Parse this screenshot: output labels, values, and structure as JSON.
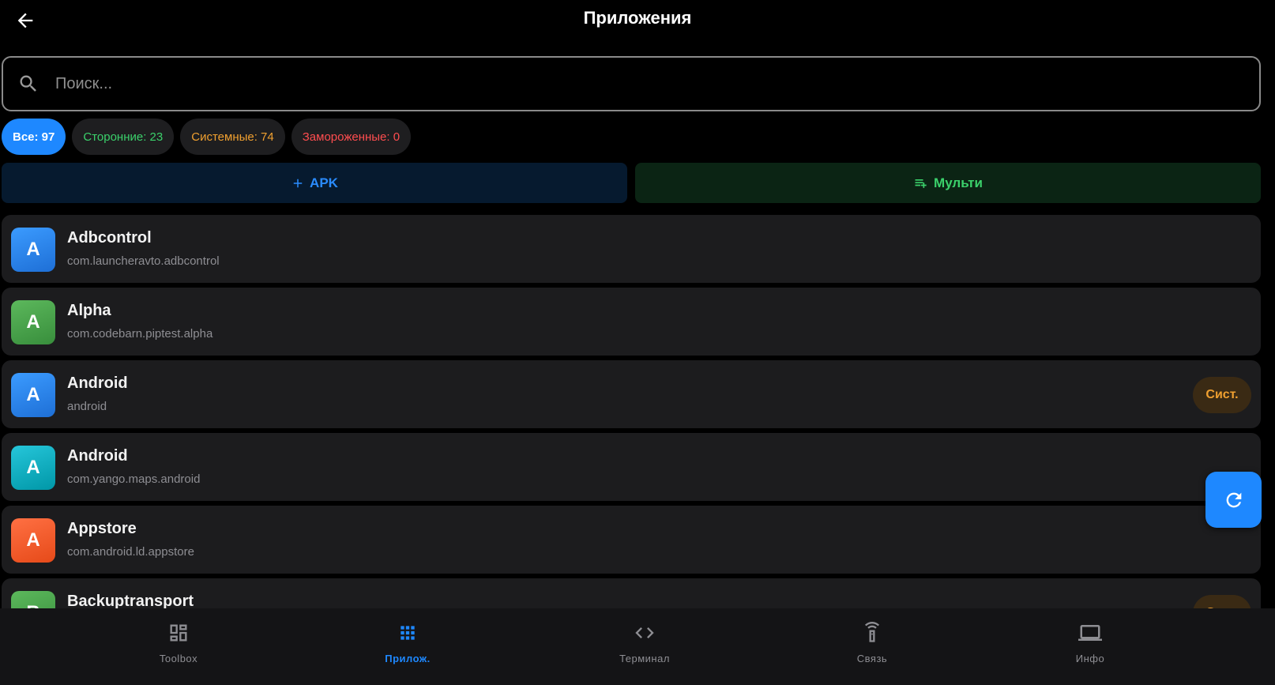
{
  "header": {
    "title": "Приложения",
    "back_icon": "arrow-left-icon"
  },
  "search": {
    "placeholder": "Поиск...",
    "value": ""
  },
  "filters": [
    {
      "label": "Все: 97",
      "color": "#ffffff",
      "active": true
    },
    {
      "label": "Сторонние: 23",
      "color": "#3bd16b",
      "active": false
    },
    {
      "label": "Системные: 74",
      "color": "#f0a030",
      "active": false
    },
    {
      "label": "Замороженные: 0",
      "color": "#ff4d4f",
      "active": false
    }
  ],
  "actions": {
    "apk_label": "APK",
    "apk_icon": "plus-icon",
    "multi_label": "Мульти",
    "multi_icon": "playlist-add-icon"
  },
  "apps": [
    {
      "letter": "A",
      "name": "Adbcontrol",
      "package": "com.launcheravto.adbcontrol",
      "icon_color": "#2a86f0",
      "system": false
    },
    {
      "letter": "A",
      "name": "Alpha",
      "package": "com.codebarn.piptest.alpha",
      "icon_color": "#43a047",
      "system": false
    },
    {
      "letter": "A",
      "name": "Android",
      "package": "android",
      "icon_color": "#2a86f0",
      "system": true
    },
    {
      "letter": "A",
      "name": "Android",
      "package": "com.yango.maps.android",
      "icon_color": "#12b0c4",
      "system": false
    },
    {
      "letter": "A",
      "name": "Appstore",
      "package": "com.android.ld.appstore",
      "icon_color": "#f4511e",
      "system": false
    },
    {
      "letter": "B",
      "name": "Backuptransport",
      "package": "",
      "icon_color": "#43a047",
      "system": true
    }
  ],
  "system_badge_label": "Сист.",
  "fab_icon": "refresh-icon",
  "bottom_nav": [
    {
      "label": "Toolbox",
      "icon": "dashboard-icon",
      "active": false
    },
    {
      "label": "Прилож.",
      "icon": "apps-grid-icon",
      "active": true
    },
    {
      "label": "Терминал",
      "icon": "code-icon",
      "active": false
    },
    {
      "label": "Связь",
      "icon": "remote-icon",
      "active": false
    },
    {
      "label": "Инфо",
      "icon": "laptop-icon",
      "active": false
    }
  ]
}
